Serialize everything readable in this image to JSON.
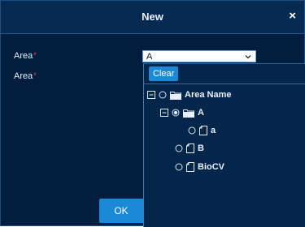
{
  "dialog": {
    "title": "New",
    "close_glyph": "×"
  },
  "form": {
    "fields": [
      {
        "label": "Area",
        "required_mark": "*"
      },
      {
        "label": "Area",
        "required_mark": "*"
      }
    ],
    "select_value": "A"
  },
  "dropdown": {
    "clear_label": "Clear",
    "tree": {
      "root": {
        "label": "Area Name",
        "expanded": true,
        "selected": false,
        "icon": "folder-icon"
      },
      "a_folder": {
        "label": "A",
        "expanded": true,
        "selected": true,
        "icon": "folder-icon"
      },
      "a_child": {
        "label": "a",
        "selected": false,
        "icon": "file-icon"
      },
      "b": {
        "label": "B",
        "selected": false,
        "icon": "file-icon"
      },
      "biocv": {
        "label": "BioCV",
        "selected": false,
        "icon": "file-icon"
      }
    }
  },
  "footer": {
    "ok_label": "OK"
  },
  "colors": {
    "background": "#021e3f",
    "accent": "#1a8ad6",
    "required": "#ff4d4f"
  }
}
